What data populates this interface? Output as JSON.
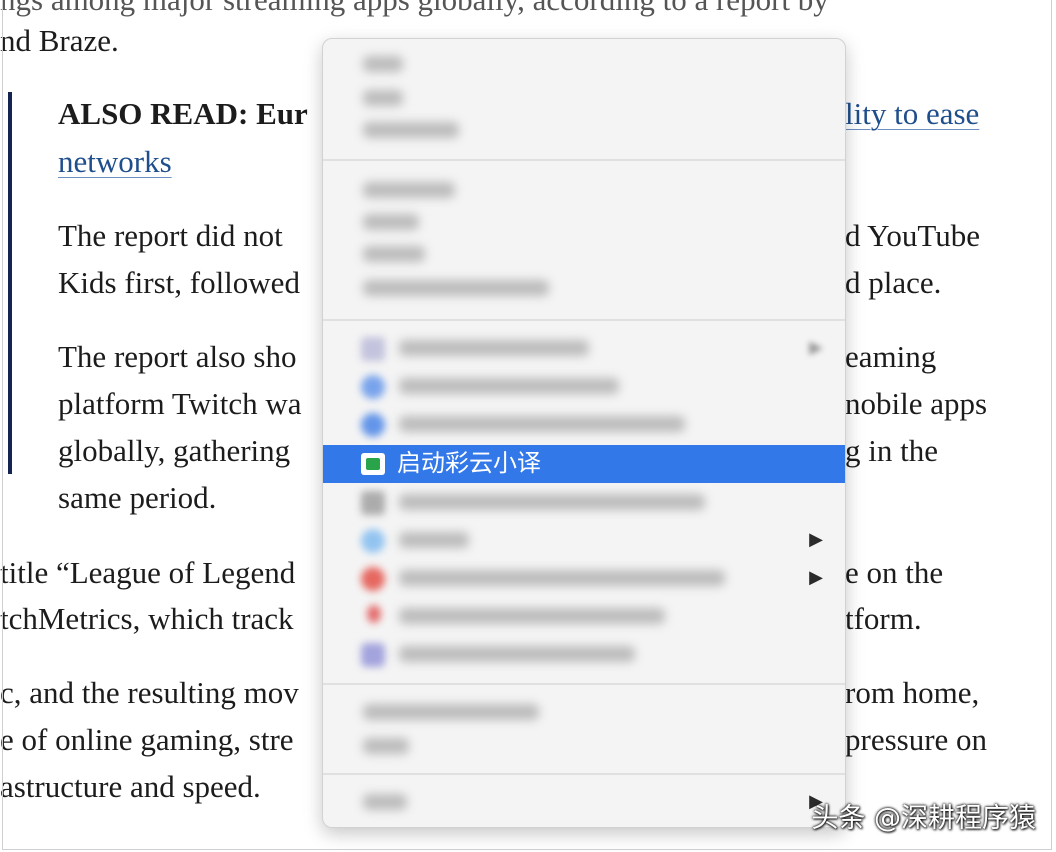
{
  "article": {
    "top_cut": "ngs among major streaming apps globally, according to a report by",
    "l1": "nd Braze.",
    "also_read_prefix": "ALSO READ: Eur",
    "also_read_link_right": "lity to ease",
    "also_read_link_wrap": "networks",
    "p1_l1_left": "The report did not",
    "p1_l1_right": "d YouTube",
    "p1_l2_left": "Kids first, followed",
    "p1_l2_right": "d place.",
    "p2_l1_left": "The report also sho",
    "p2_l1_right": "eaming",
    "p2_l2_left": "platform Twitch wa",
    "p2_l2_right": "nobile apps",
    "p2_l3_left": "globally, gathering",
    "p2_l3_right": "g in the",
    "p2_l4": "same period.",
    "p3_l1_left": "title “League of Legend",
    "p3_l1_right": "e on the",
    "p3_l2_left": "tchMetrics, which track",
    "p3_l2_right": "tform.",
    "p4_l1_left": "c, and the resulting mov",
    "p4_l1_right": "rom home,",
    "p4_l2_left": "e of online gaming, stre",
    "p4_l2_right": "pressure on",
    "p4_l3_left": "astructure and speed."
  },
  "context_menu": {
    "highlighted_item": {
      "label": "启动彩云小译",
      "icon": "caiyun-translate-icon"
    },
    "submenu_arrow": "▶",
    "arrow_char": "▶"
  },
  "watermark": "头条 @深耕程序猿",
  "colors": {
    "highlight": "#3378e9",
    "link": "#1f4e8c",
    "quote_bar": "#12244f"
  }
}
